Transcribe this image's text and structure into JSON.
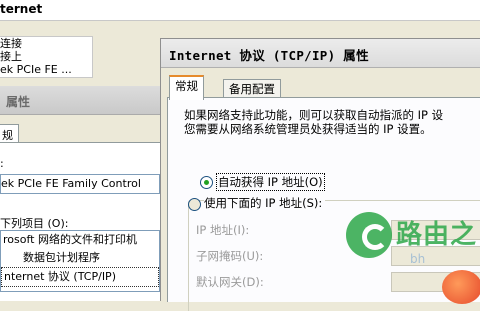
{
  "bg": {
    "top_text": "ternet",
    "list_items": [
      "连接",
      "接上",
      "ek PCIe FE ..."
    ],
    "title": "属性",
    "tab": "规",
    "connect_using_partial": ":",
    "adapter": "ek PCIe FE Family Control",
    "items_label": "下列项目 (O):",
    "items": [
      "rosoft 网络的文件和打印机",
      "数据包计划程序",
      "nternet 协议 (TCP/IP)"
    ]
  },
  "dialog": {
    "title": "Internet 协议 (TCP/IP) 属性",
    "tabs": [
      "常规",
      "备用配置"
    ],
    "description_line1": "如果网络支持此功能，则可以获取自动指派的 IP 设",
    "description_line2": "您需要从网络系统管理员处获得适当的 IP 设置。",
    "radio_auto": "自动获得 IP 地址(O)",
    "radio_manual": "使用下面的 IP 地址(S):",
    "fields": [
      "IP 地址(I):",
      "子网掩码(U):",
      "默认网关(D):"
    ]
  },
  "watermark": {
    "text": "路由之",
    "sub": "bh"
  },
  "colors": {
    "tab_accent": "#e68b2c",
    "radio_dot": "#21a121",
    "watermark_green": "#2ea84a"
  }
}
